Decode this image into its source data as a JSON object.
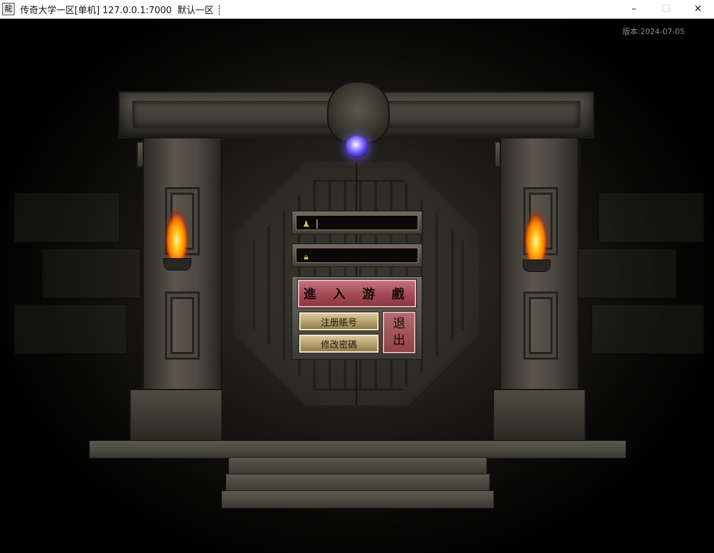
{
  "window": {
    "title": "传奇大学一区[单机] 127.0.0.1:7000  默认一区 ┊",
    "icon_glyph": "龍",
    "separator": "┊",
    "controls": {
      "minimize": "–",
      "maximize": "☐",
      "close": "✕"
    }
  },
  "version_label": "版本:2024-07-05",
  "login": {
    "username_icon": "user-icon",
    "password_icon": "lock-icon",
    "username_value": "",
    "password_value": "",
    "enter_game_label": "進 入 游 戲",
    "register_label": "注册賬号",
    "change_password_label": "修改密碼",
    "exit_label_top": "退",
    "exit_label_bottom": "出"
  },
  "colors": {
    "enter_button": "#a44a56",
    "small_button": "#b19a6a",
    "exit_button": "#8e4349",
    "orb": "#6e5cff",
    "flame": "#ffc21a"
  }
}
